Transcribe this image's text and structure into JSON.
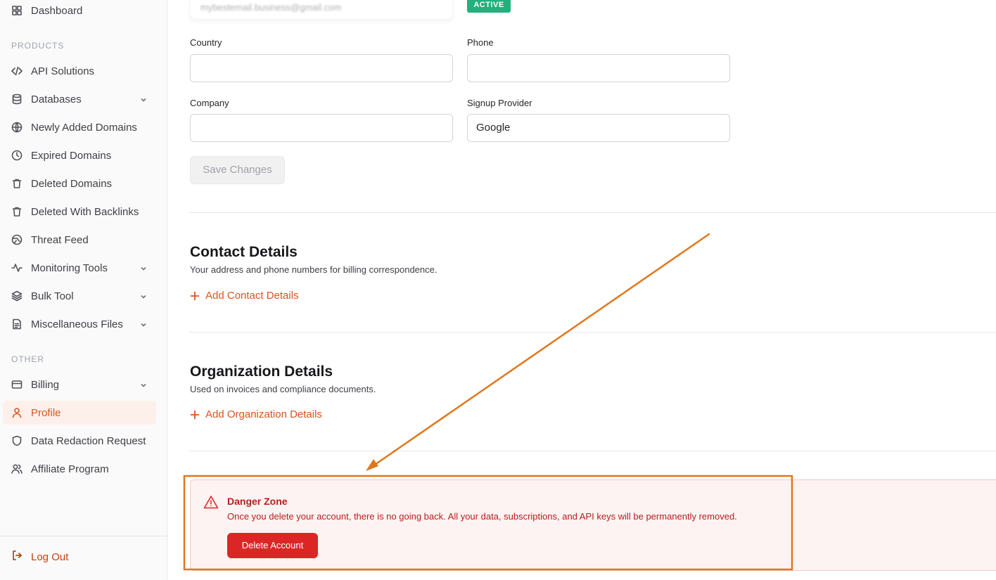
{
  "sidebar": {
    "dashboard": "Dashboard",
    "products_label": "PRODUCTS",
    "products": [
      {
        "label": "API Solutions",
        "icon": "code-icon"
      },
      {
        "label": "Databases",
        "icon": "database-icon"
      },
      {
        "label": "Newly Added Domains",
        "icon": "globe-icon"
      },
      {
        "label": "Expired Domains",
        "icon": "clock-icon"
      },
      {
        "label": "Deleted Domains",
        "icon": "trash-icon"
      },
      {
        "label": "Deleted With Backlinks",
        "icon": "trash-icon"
      },
      {
        "label": "Threat Feed",
        "icon": "globe-icon"
      },
      {
        "label": "Monitoring Tools",
        "icon": "activity-icon"
      },
      {
        "label": "Bulk Tool",
        "icon": "layers-icon"
      },
      {
        "label": "Miscellaneous Files",
        "icon": "file-icon"
      }
    ],
    "other_label": "OTHER",
    "other": [
      {
        "label": "Billing",
        "icon": "credit-card-icon"
      },
      {
        "label": "Profile",
        "icon": "user-icon"
      },
      {
        "label": "Data Redaction Request",
        "icon": "shield-icon"
      },
      {
        "label": "Affiliate Program",
        "icon": "users-icon"
      }
    ],
    "logout": "Log Out"
  },
  "profile_form": {
    "email_value": "mybestemail.business@gmail.com",
    "status_badge": "ACTIVE",
    "country_label": "Country",
    "country_value": "",
    "phone_label": "Phone",
    "phone_value": "",
    "company_label": "Company",
    "company_value": "",
    "signup_provider_label": "Signup Provider",
    "signup_provider_value": "Google",
    "save_button": "Save Changes"
  },
  "contact_details": {
    "title": "Contact Details",
    "subtitle": "Your address and phone numbers for billing correspondence.",
    "add_link": "Add Contact Details"
  },
  "organization_details": {
    "title": "Organization Details",
    "subtitle": "Used on invoices and compliance documents.",
    "add_link": "Add Organization Details"
  },
  "danger_zone": {
    "title": "Danger Zone",
    "text": "Once you delete your account, there is no going back. All your data, subscriptions, and API keys will be permanently removed.",
    "delete_button": "Delete Account"
  },
  "colors": {
    "accent": "#d9531e",
    "danger": "#dc2626",
    "badge": "#22b07d",
    "annotation": "#e0761c"
  }
}
